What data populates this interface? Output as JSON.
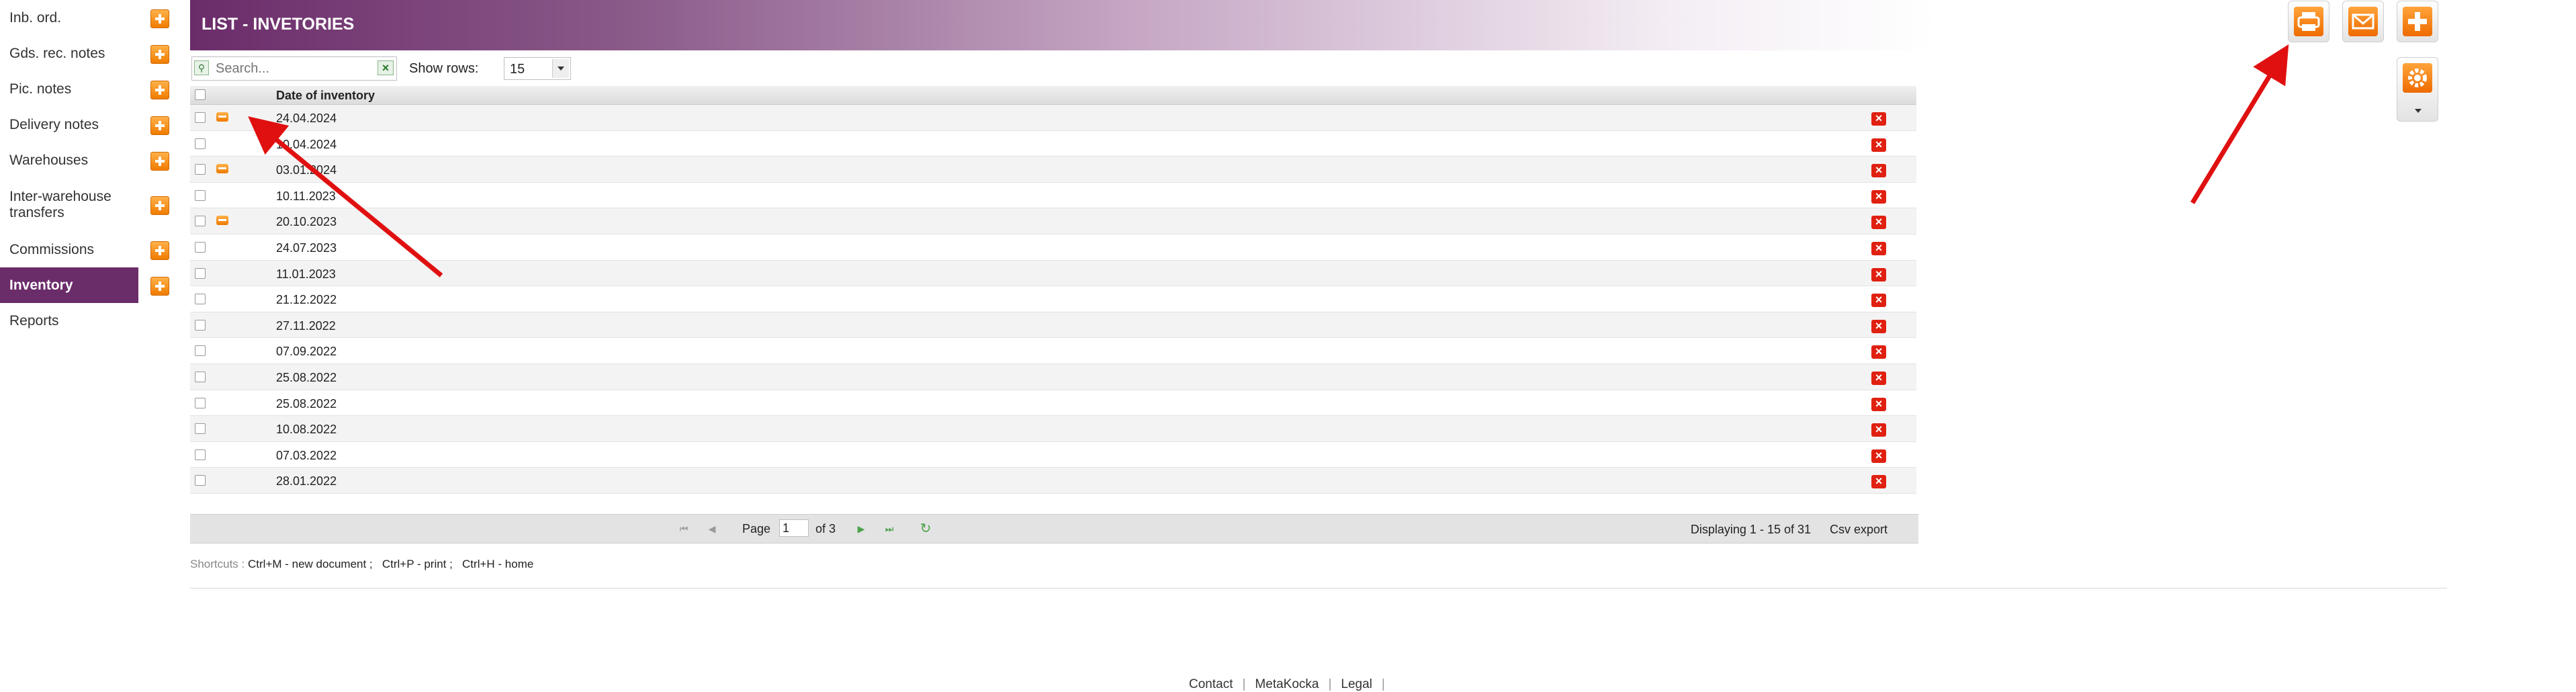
{
  "sidebar": {
    "items": [
      {
        "label": "Inb. ord.",
        "add": true
      },
      {
        "label": "Gds. rec. notes",
        "add": true
      },
      {
        "label": "Pic. notes",
        "add": true
      },
      {
        "label": "Delivery notes",
        "add": true
      },
      {
        "label": "Warehouses",
        "add": true
      },
      {
        "label": "Inter-warehouse transfers",
        "add": true
      },
      {
        "label": "Commissions",
        "add": true
      },
      {
        "label": "Inventory",
        "add": true,
        "active": true
      },
      {
        "label": "Reports",
        "add": false
      }
    ]
  },
  "header": {
    "title": "LIST - INVETORIES"
  },
  "toolbar": {
    "search_placeholder": "Search...",
    "show_rows_label": "Show rows:",
    "rows_value": "15"
  },
  "grid": {
    "column_date": "Date of inventory",
    "rows": [
      {
        "date": "24.04.2024",
        "printed": true
      },
      {
        "date": "10.04.2024",
        "printed": false
      },
      {
        "date": "03.01.2024",
        "printed": true
      },
      {
        "date": "10.11.2023",
        "printed": false
      },
      {
        "date": "20.10.2023",
        "printed": true
      },
      {
        "date": "24.07.2023",
        "printed": false
      },
      {
        "date": "11.01.2023",
        "printed": false
      },
      {
        "date": "21.12.2022",
        "printed": false
      },
      {
        "date": "27.11.2022",
        "printed": false
      },
      {
        "date": "07.09.2022",
        "printed": false
      },
      {
        "date": "25.08.2022",
        "printed": false
      },
      {
        "date": "25.08.2022",
        "printed": false
      },
      {
        "date": "10.08.2022",
        "printed": false
      },
      {
        "date": "07.03.2022",
        "printed": false
      },
      {
        "date": "28.01.2022",
        "printed": false
      }
    ]
  },
  "pager": {
    "page_label": "Page",
    "page_value": "1",
    "of_label": "of 3",
    "displaying": "Displaying 1 - 15 of 31",
    "csv_export": "Csv export"
  },
  "shortcuts": {
    "label": "Shortcuts :",
    "items": [
      "Ctrl+M - new document ;",
      "Ctrl+P - print ;",
      "Ctrl+H - home"
    ]
  },
  "footer": {
    "links": [
      "Contact",
      "MetaKocka",
      "Legal"
    ]
  },
  "colors": {
    "brand": "#6b2c6a",
    "accent": "#f07c00",
    "delete": "#e02010",
    "annotation": "#e01010"
  }
}
